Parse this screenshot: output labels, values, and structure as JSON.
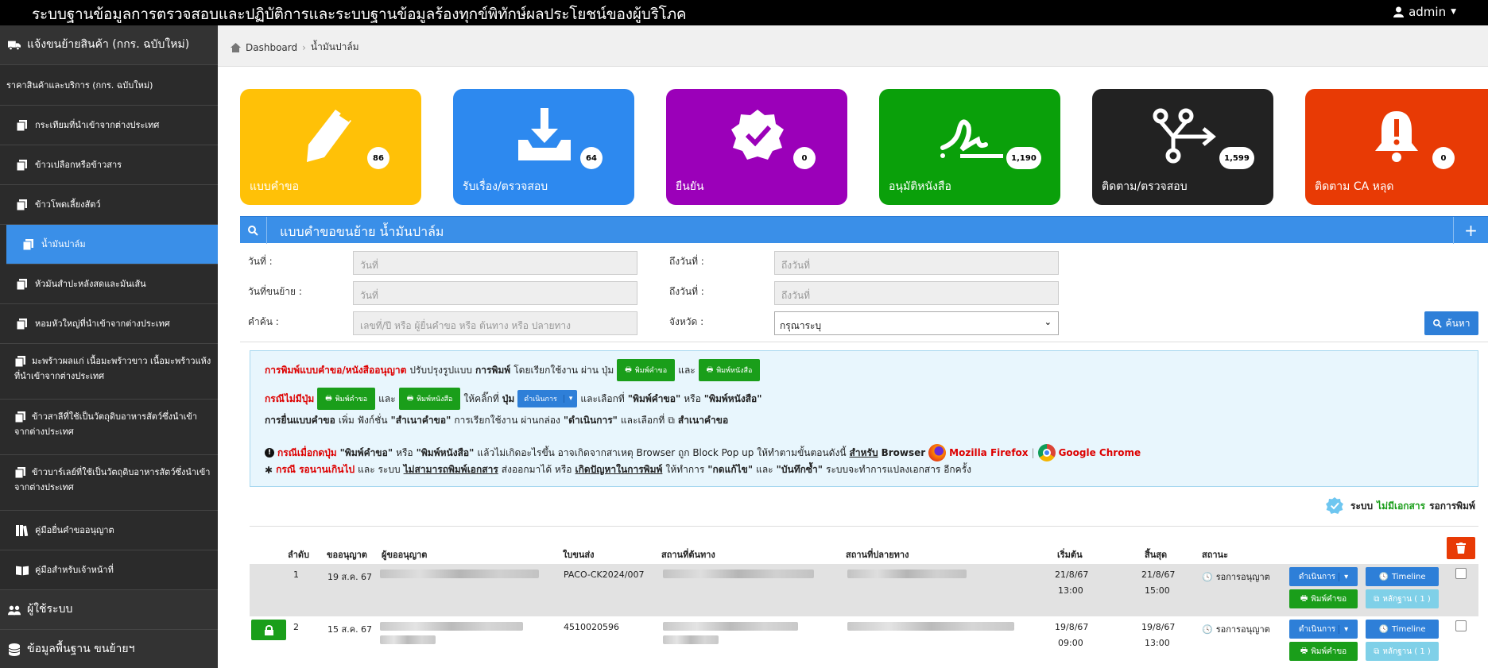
{
  "header": {
    "title": "ระบบฐานข้อมูลการตรวจสอบและปฏิบัติการและระบบฐานข้อมูลร้องทุกข์พิทักษ์ผลประโยชน์ของผู้บริโภค",
    "user": "admin"
  },
  "sidebar": {
    "main_top": "แจ้งขนย้ายสินค้า (กกร. ฉบับใหม่)",
    "section": "ราคาสินค้าและบริการ (กกร. ฉบับใหม่)",
    "items": [
      {
        "label": "กระเทียมที่นำเข้าจากต่างประเทศ"
      },
      {
        "label": "ข้าวเปลือกหรือข้าวสาร"
      },
      {
        "label": "ข้าวโพดเลี้ยงสัตว์"
      },
      {
        "label": "น้ำมันปาล์ม"
      },
      {
        "label": "หัวมันสำปะหลังสดและมันเส้น"
      },
      {
        "label": "หอมหัวใหญ่ที่นำเข้าจากต่างประเทศ"
      },
      {
        "label": "มะพร้าวผลแก่ เนื้อมะพร้าวขาว เนื้อมะพร้าวแห้ง ที่นำเข้าจากต่างประเทศ"
      },
      {
        "label": "ข้าวสาลีที่ใช้เป็นวัตถุดิบอาหารสัตว์ซึ่งนำเข้าจากต่างประเทศ"
      },
      {
        "label": "ข้าวบาร์เลย์ที่ใช้เป็นวัตถุดิบอาหารสัตว์ซึ่งนำเข้าจากต่างประเทศ"
      },
      {
        "label": "คู่มือยื่นคำขออนุญาต"
      },
      {
        "label": "คู่มือสำหรับเจ้าหน้าที่"
      }
    ],
    "main_users": "ผู้ใช้ระบบ",
    "main_data": "ข้อมูลพื้นฐาน ขนย้ายฯ"
  },
  "breadcrumb": {
    "home": "Dashboard",
    "current": "น้ำมันปาล์ม"
  },
  "cards": [
    {
      "label": "แบบคำขอ",
      "count": "86",
      "color": "#ffc107"
    },
    {
      "label": "รับเรื่อง/ตรวจสอบ",
      "count": "64",
      "color": "#2d89ef"
    },
    {
      "label": "ยืนยัน",
      "count": "0",
      "color": "#9b00b9"
    },
    {
      "label": "อนุมัติหนังสือ",
      "count": "1,190",
      "color": "#0aa00a"
    },
    {
      "label": "ติดตาม/ตรวจสอบ",
      "count": "1,599",
      "color": "#222222"
    },
    {
      "label": "ติดตาม CA หลุด",
      "count": "0",
      "color": "#e83a05"
    }
  ],
  "panel": {
    "title": "แบบคำขอขนย้าย น้ำมันปาล์ม"
  },
  "form": {
    "date_label": "วันที่ :",
    "date_ph": "วันที่",
    "to_date_label": "ถึงวันที่ :",
    "to_date_ph": "ถึงวันที่",
    "move_date_label": "วันที่ขนย้าย :",
    "move_date_ph": "วันที่",
    "to_date2_label": "ถึงวันที่ :",
    "to_date2_ph": "ถึงวันที่",
    "keyword_label": "คำค้น :",
    "keyword_ph": "เลขที่/ปี หรือ ผู้ยื่นคำขอ หรือ ต้นทาง หรือ ปลายทาง",
    "province_label": "จังหวัด :",
    "province_value": "กรุณาระบุ",
    "search_btn": "ค้นหา"
  },
  "info": {
    "l1_a": "การพิมพ์แบบคำขอ/หนังสืออนุญาต",
    "l1_b": "ปรับปรุงรูปแบบ",
    "l1_c": "การพิมพ์",
    "l1_d": "โดยเรียกใช้งาน ผ่าน ปุ่ม",
    "l1_e": "และ",
    "btn_print_req": "พิมพ์คำขอ",
    "btn_print_book": "พิมพ์หนังสือ",
    "l2_a": "กรณีไม่มีปุ่ม",
    "l2_b": "และ",
    "l2_c": "ให้คลิ๊กที่",
    "l2_d": "ปุ่ม",
    "l2_e": "และเลือกที่",
    "l2_f": "\"พิมพ์คำขอ\"",
    "l2_g": "หรือ",
    "l2_h": "\"พิมพ์หนังสือ\"",
    "btn_action": "ดำเนินการ",
    "l3_a": "การยื่นแบบคำขอ",
    "l3_b": "เพิ่ม ฟังก์ชั่น",
    "l3_c": "\"สำเนาคำขอ\"",
    "l3_d": "การเรียกใช้งาน ผ่านกล่อง",
    "l3_e": "\"ดำเนินการ\"",
    "l3_f": "และเลือกที่",
    "l3_g": "สำเนาคำขอ",
    "l4_a": "กรณีเมื่อกดปุ่ม",
    "l4_b": "\"พิมพ์คำขอ\"",
    "l4_c": "หรือ",
    "l4_d": "\"พิมพ์หนังสือ\"",
    "l4_e": "แล้วไม่เกิดอะไรขึ้น อาจเกิดจากสาเหตุ Browser ถูก Block Pop up ให้ทำตามขั้นตอนดังนี้",
    "l4_f": "สำหรับ",
    "l4_g": "Browser",
    "l4_h": "Mozilla Firefox",
    "l4_i": "|",
    "l4_j": "Google Chrome",
    "l5_a": "กรณี รอนานเกินไป",
    "l5_b": "และ ระบบ",
    "l5_c": "ไม่สามารถพิมพ์เอกสาร",
    "l5_d": "ส่งออกมาได้ หรือ",
    "l5_e": "เกิดปัญหาในการพิมพ์",
    "l5_f": "ให้ทำการ",
    "l5_g": "\"กดแก้ไข\"",
    "l5_h": "และ",
    "l5_i": "\"บันทึกซ้ำ\"",
    "l5_j": "ระบบจะทำการแปลงเอกสาร อีกครั้ง"
  },
  "legend": {
    "a": "ระบบ",
    "b": "ไม่มีเอกสาร",
    "c": "รอการพิมพ์"
  },
  "table": {
    "headers": [
      "ลำดับ",
      "ขออนุญาต",
      "ผู้ขออนุญาต",
      "ใบขนส่ง",
      "สถานที่ต้นทาง",
      "สถานที่ปลายทาง",
      "เริ่มต้น",
      "สิ้นสุด",
      "สถานะ"
    ],
    "rows": [
      {
        "no": "1",
        "date": "19 ส.ค. 67",
        "doc": "PACO-CK2024/007",
        "start_d": "21/8/67",
        "start_t": "13:00",
        "end_d": "21/8/67",
        "end_t": "15:00",
        "status": "รอการอนุญาต",
        "btn_action": "ดำเนินการ",
        "btn_timeline": "Timeline",
        "btn_print": "พิมพ์คำขอ",
        "btn_evidence": "หลักฐาน ( 1 )"
      },
      {
        "no": "2",
        "date": "15 ส.ค. 67",
        "doc": "4510020596",
        "start_d": "19/8/67",
        "start_t": "09:00",
        "end_d": "19/8/67",
        "end_t": "13:00",
        "status": "รอการอนุญาต",
        "btn_action": "ดำเนินการ",
        "btn_timeline": "Timeline",
        "btn_print": "พิมพ์คำขอ",
        "btn_evidence": "หลักฐาน ( 1 )"
      }
    ]
  }
}
